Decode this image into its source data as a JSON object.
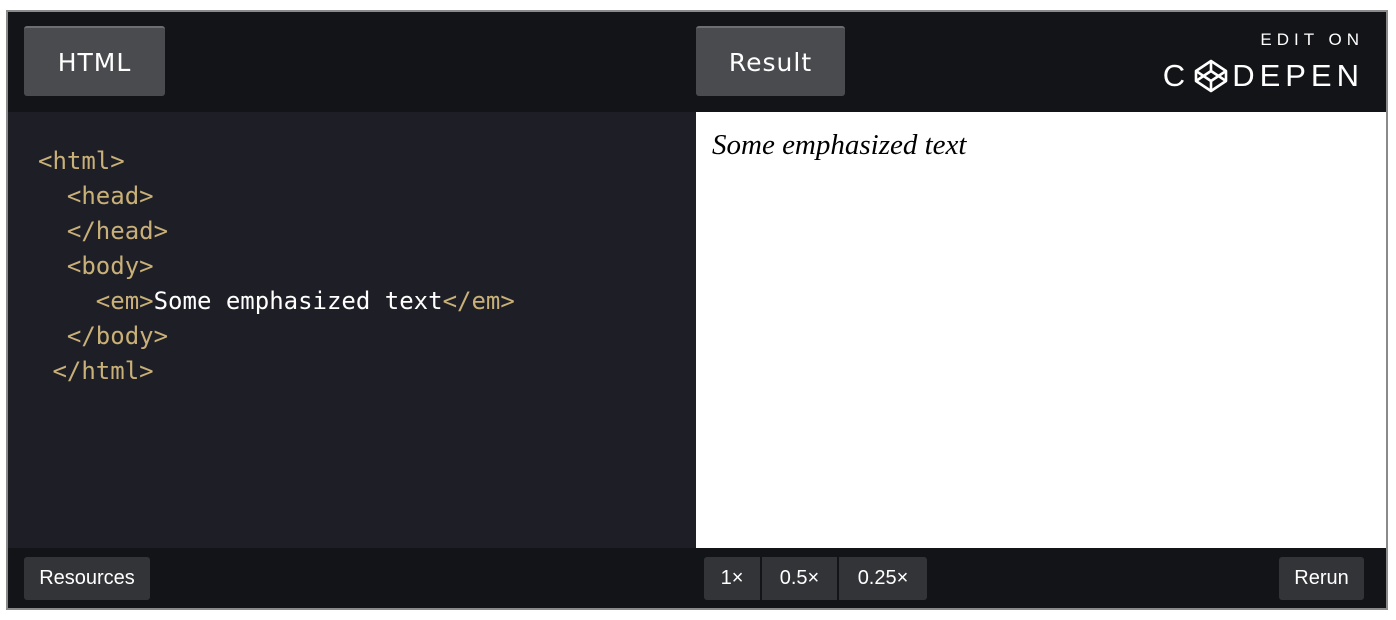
{
  "header": {
    "tab_html": "HTML",
    "tab_result": "Result",
    "brand_top": "EDIT ON",
    "brand_bottom_left": "C",
    "brand_bottom_right": "DEPEN",
    "brand_logo_icon": "codepen-cube-icon"
  },
  "code": {
    "lines": [
      {
        "indent": "",
        "parts": [
          {
            "t": "<html>",
            "k": "tag"
          }
        ]
      },
      {
        "indent": "  ",
        "parts": [
          {
            "t": "<head>",
            "k": "tag"
          }
        ]
      },
      {
        "indent": "  ",
        "parts": [
          {
            "t": "</head>",
            "k": "tag"
          }
        ]
      },
      {
        "indent": "  ",
        "parts": [
          {
            "t": "<body>",
            "k": "tag"
          }
        ]
      },
      {
        "indent": "    ",
        "parts": [
          {
            "t": "<em>",
            "k": "tag"
          },
          {
            "t": "Some emphasized text",
            "k": "text"
          },
          {
            "t": "</em>",
            "k": "tag"
          }
        ]
      },
      {
        "indent": "  ",
        "parts": [
          {
            "t": "</body>",
            "k": "tag"
          }
        ]
      },
      {
        "indent": " ",
        "parts": [
          {
            "t": "</html>",
            "k": "tag"
          }
        ]
      }
    ]
  },
  "result": {
    "text": "Some emphasized text"
  },
  "footer": {
    "resources_label": "Resources",
    "zoom_options": [
      "1×",
      "0.5×",
      "0.25×"
    ],
    "rerun_label": "Rerun"
  },
  "colors": {
    "background": "#131417",
    "code_background": "#1e1f26",
    "tag_color": "#c9b078",
    "tab_background": "#4a4b4f",
    "button_background": "#333438"
  }
}
